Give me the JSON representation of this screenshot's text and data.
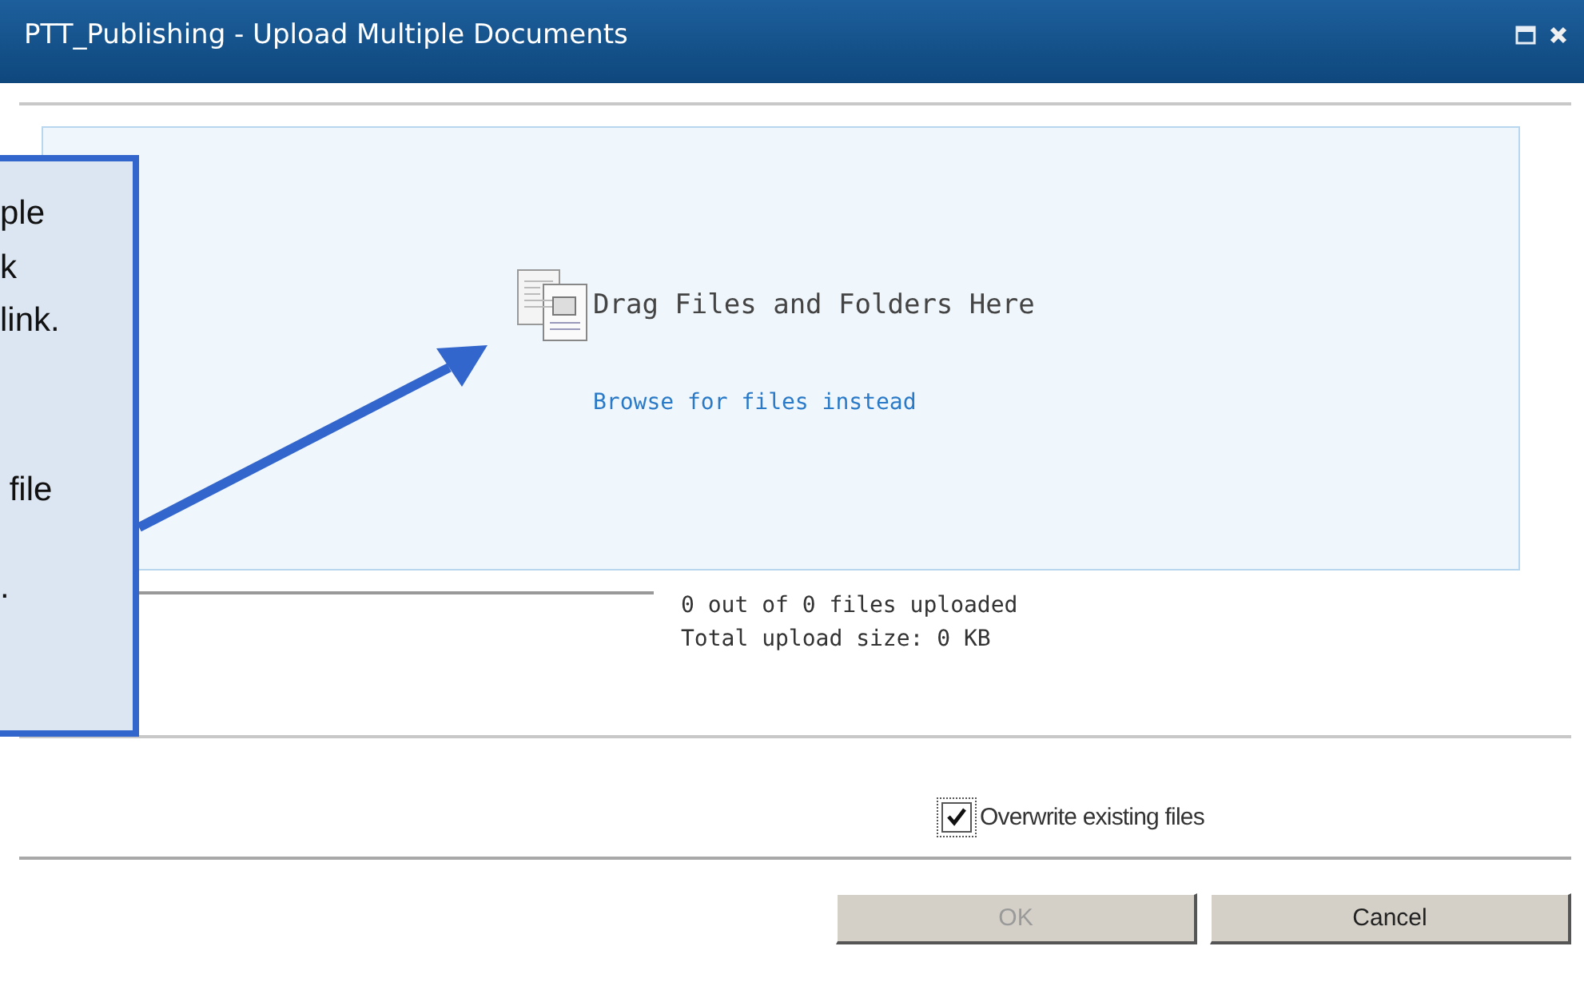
{
  "window": {
    "title": "PTT_Publishing - Upload Multiple Documents"
  },
  "drop_zone": {
    "heading": "Drag Files and Folders Here",
    "link": "Browse for files instead"
  },
  "upload_status": [
    "0 out of 0 files uploaded",
    "Total upload size: 0 KB"
  ],
  "options": [
    {
      "label": "Overwrite existing files",
      "checked": true
    }
  ],
  "buttons": [
    {
      "label": "OK",
      "disabled": true
    },
    {
      "label": "Cancel",
      "disabled": false
    }
  ],
  "callout": {
    "paragraphs": [
      [
        "ple",
        "k",
        "link."
      ],
      [
        " file"
      ],
      [
        "."
      ]
    ]
  }
}
